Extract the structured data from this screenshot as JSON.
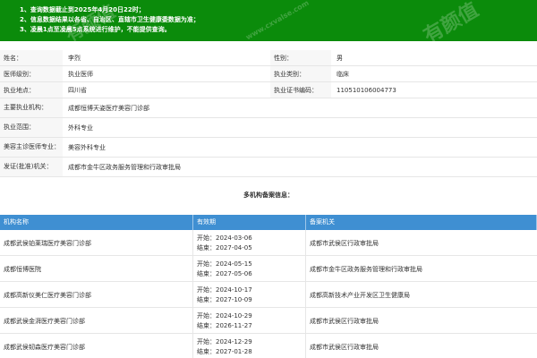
{
  "notice": {
    "lines": [
      "1、查询数据截止到2025年4月20日22时；",
      "2、信息数据结果以各省、自治区、直辖市卫生健康委数据为准；",
      "3、凌晨1点至凌晨5点系统进行维护，不能提供查询。"
    ],
    "watermark": "有颜值",
    "watermark_url": "www.cxvalse.com"
  },
  "doctor": {
    "name_label": "姓名：",
    "name": "李烈",
    "gender_label": "性别：",
    "gender": "男",
    "level_label": "医师级别：",
    "level": "执业医师",
    "category_label": "执业类别：",
    "category": "临床",
    "location_label": "执业地点：",
    "location": "四川省",
    "cert_label": "执业证书编码：",
    "cert": "110510106004773",
    "org_label": "主要执业机构：",
    "org": "成都恒博天姿医疗美容门诊部",
    "scope_label": "执业范围：",
    "scope": "外科专业",
    "beauty_label": "美容主诊医师专业：",
    "beauty": "美容外科专业",
    "authority_label": "发证(批准)机关：",
    "authority": "成都市金牛区政务服务管理和行政审批局"
  },
  "multi": {
    "title": "多机构备案信息：",
    "headers": [
      "机构名称",
      "有效期",
      "备案机关"
    ],
    "start_prefix": "开始：",
    "end_prefix": "结束：",
    "rows": [
      {
        "name": "成都武侯铂莱瑞医疗美容门诊部",
        "start": "2024-03-06",
        "end": "2027-04-05",
        "authority": "成都市武侯区行政审批局"
      },
      {
        "name": "成都恒博医院",
        "start": "2024-05-15",
        "end": "2027-05-06",
        "authority": "成都市金牛区政务服务管理和行政审批局"
      },
      {
        "name": "成都高新仪美仁医疗美容门诊部",
        "start": "2024-10-17",
        "end": "2027-10-09",
        "authority": "成都高新技术产业开发区卫生健康局"
      },
      {
        "name": "成都武侯金湃医疗美容门诊部",
        "start": "2024-10-29",
        "end": "2026-11-27",
        "authority": "成都市武侯区行政审批局"
      },
      {
        "name": "成都武侯韧森医疗美容门诊部",
        "start": "2024-12-29",
        "end": "2027-01-28",
        "authority": "成都市武侯区行政审批局"
      }
    ]
  },
  "colors": {
    "notice_bg": "#0b8b0b",
    "table_header": "#3f8fd2"
  }
}
